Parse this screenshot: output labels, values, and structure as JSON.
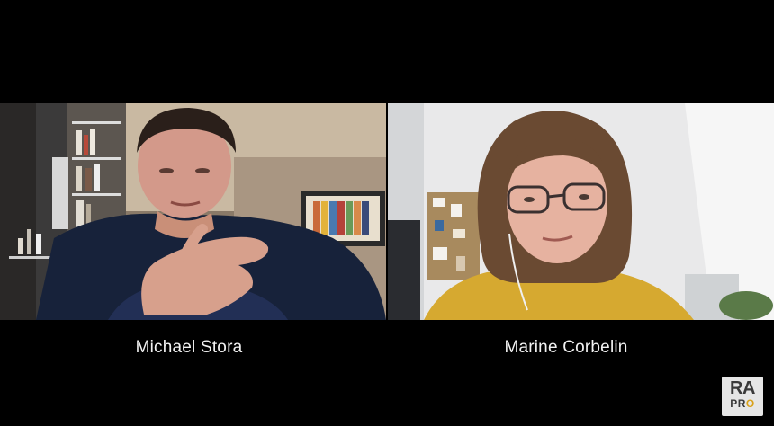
{
  "participants": [
    {
      "name": "Michael Stora"
    },
    {
      "name": "Marine Corbelin"
    }
  ],
  "logo": {
    "text_main": "RA",
    "text_sub_prefix": "PR",
    "text_sub_accent": "O"
  },
  "colors": {
    "background": "#000000",
    "label_text": "#f2f2f2",
    "logo_bg": "#e6e6e6",
    "logo_accent": "#d9a21b"
  }
}
